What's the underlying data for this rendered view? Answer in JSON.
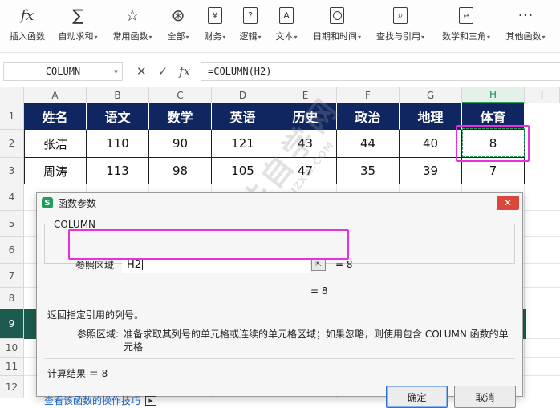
{
  "ribbon": {
    "items": [
      {
        "label": "插入函数",
        "icon": "fx-icon",
        "glyph": "fx",
        "caret": false
      },
      {
        "label": "自动求和",
        "icon": "sigma-icon",
        "glyph": "∑",
        "caret": true
      },
      {
        "label": "常用函数",
        "icon": "star-icon",
        "glyph": "☆",
        "caret": true
      },
      {
        "label": "全部",
        "icon": "all-functions-icon",
        "glyph": "⊛",
        "caret": true
      },
      {
        "label": "财务",
        "icon": "yen-icon",
        "glyph": "¥",
        "caret": true
      },
      {
        "label": "逻辑",
        "icon": "question-icon",
        "glyph": "?",
        "caret": true
      },
      {
        "label": "文本",
        "icon": "text-a-icon",
        "glyph": "A",
        "caret": true
      },
      {
        "label": "日期和时间",
        "icon": "clock-icon",
        "glyph": "",
        "caret": true
      },
      {
        "label": "查找与引用",
        "icon": "lookup-search-icon",
        "glyph": "⌕",
        "caret": true
      },
      {
        "label": "数学和三角",
        "icon": "math-e-icon",
        "glyph": "e",
        "caret": true
      },
      {
        "label": "其他函数",
        "icon": "more-dots-icon",
        "glyph": "···",
        "caret": true
      }
    ]
  },
  "formula_bar": {
    "name_box": "COLUMN",
    "formula": "=COLUMN(H2)"
  },
  "sheet": {
    "columns": [
      "A",
      "B",
      "C",
      "D",
      "E",
      "F",
      "G",
      "H",
      "I"
    ],
    "rows": [
      "1",
      "2",
      "3",
      "4",
      "5",
      "6",
      "7",
      "8",
      "9",
      "10",
      "11",
      "12"
    ],
    "header": [
      "姓名",
      "语文",
      "数学",
      "英语",
      "历史",
      "政治",
      "地理",
      "体育"
    ],
    "data": [
      [
        "张洁",
        "110",
        "90",
        "121",
        "43",
        "44",
        "40",
        "8"
      ],
      [
        "周涛",
        "113",
        "98",
        "105",
        "47",
        "35",
        "39",
        "7"
      ]
    ]
  },
  "watermark": {
    "text": "软件自学网",
    "sub": "WWW.RJZXW.COM"
  },
  "dialog": {
    "title": "函数参数",
    "logo": "S",
    "function_name": "COLUMN",
    "arg_label": "参照区域",
    "arg_value": "H2",
    "arg_result": "= 8",
    "formula_result": "= 8",
    "description": "返回指定引用的列号。",
    "param_label": "参照区域:",
    "param_desc": "准备求取其列号的单元格或连续的单元格区域；如果忽略，则使用包含 COLUMN 函数的单元格",
    "calc_result": "计算结果 ＝ 8",
    "help_link": "查看该函数的操作技巧",
    "ok_label": "确定",
    "cancel_label": "取消"
  },
  "colors": {
    "header_bg": "#0f2660",
    "selected_col": "#2aa05d",
    "highlight_box": "#e434d9",
    "close_button": "#d9483b"
  }
}
